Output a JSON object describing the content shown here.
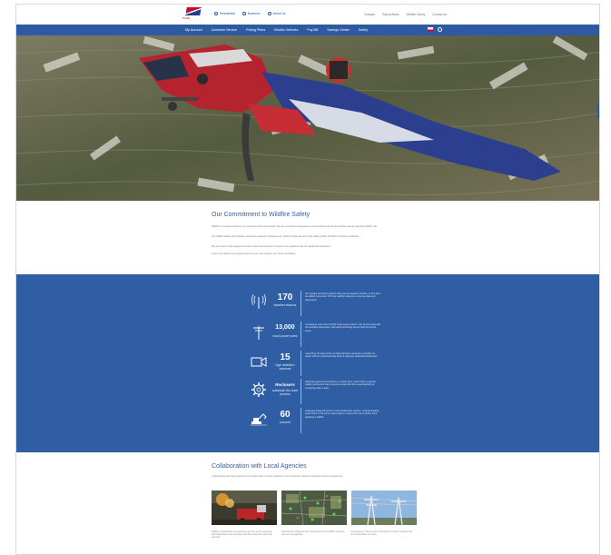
{
  "header": {
    "logo_text": "PG&E",
    "lang_links": [
      "Residential",
      "Business",
      "About Us"
    ],
    "util_links": [
      "Outages",
      "Report Alerts",
      "Wildfire Safety",
      "Contact Us"
    ]
  },
  "nav": {
    "items": [
      "My Account",
      "Customer Service",
      "Pricing Plans",
      "Electric Vehicles",
      "Pay Bill",
      "Savings Center",
      "Safety"
    ]
  },
  "commitment": {
    "title": "Our Commitment to Wildfire Safety",
    "paragraphs": [
      "Wildfire is a serious threat to our customers and communities. We are committed to keeping our communities and service territory safe by reducing wildfire risk.",
      "Our wildfire safety plan includes enhanced vegetation management, system hardening and public safety power shutoffs in extreme conditions.",
      "We are proud of the progress we have made and continue to improve our programs and our situational awareness.",
      "Learn more about our programs and how you can prepare your home and family."
    ]
  },
  "stats": [
    {
      "num": "170",
      "unit": "weather stations",
      "desc": "We operate America's largest utility-owned weather network. In this area we added more than 170 new weather stations to improve data and awareness."
    },
    {
      "num": "13,000",
      "unit": "wood power poles",
      "desc": "Completing more than 13,000 wood power poles in the service area with fire-resistant steel poles, with work continuing across high fire-threat areas."
    },
    {
      "num": "15",
      "unit": "high definition cameras",
      "desc": "Launching 15 state-of-the-art high definition cameras to provide our region with an unprecedented level of real-time situational awareness."
    },
    {
      "num": "Reclosers",
      "unit": "automate the reset process",
      "desc": "Deploying advanced reclosers on power lines, which have a special safety mechanism that prevents a power line from automatically re-energizing after a fault."
    },
    {
      "num": "60",
      "unit": "percent",
      "desc": "Undergrounding 60 percent of our distribution system. Undergrounding power lines in fire-prone areas helps to reduce the risk of power lines sparking a wildfire."
    }
  ],
  "collab": {
    "title": "Collaboration with Local Agencies",
    "sub": "Collaborating with local agencies has helped plan for these initiatives, and coordinate response strategies during emergencies.",
    "cards": [
      {
        "text": "Wildfire preparedness has been the top focus of our equipment and maintenance teams working with first responders and local agencies."
      },
      {
        "text": "Thermal technology has been developed for our wildfire response team to help agencies."
      },
      {
        "text": "Investments in this area are improving our safety measures and the communities we serve."
      }
    ]
  }
}
